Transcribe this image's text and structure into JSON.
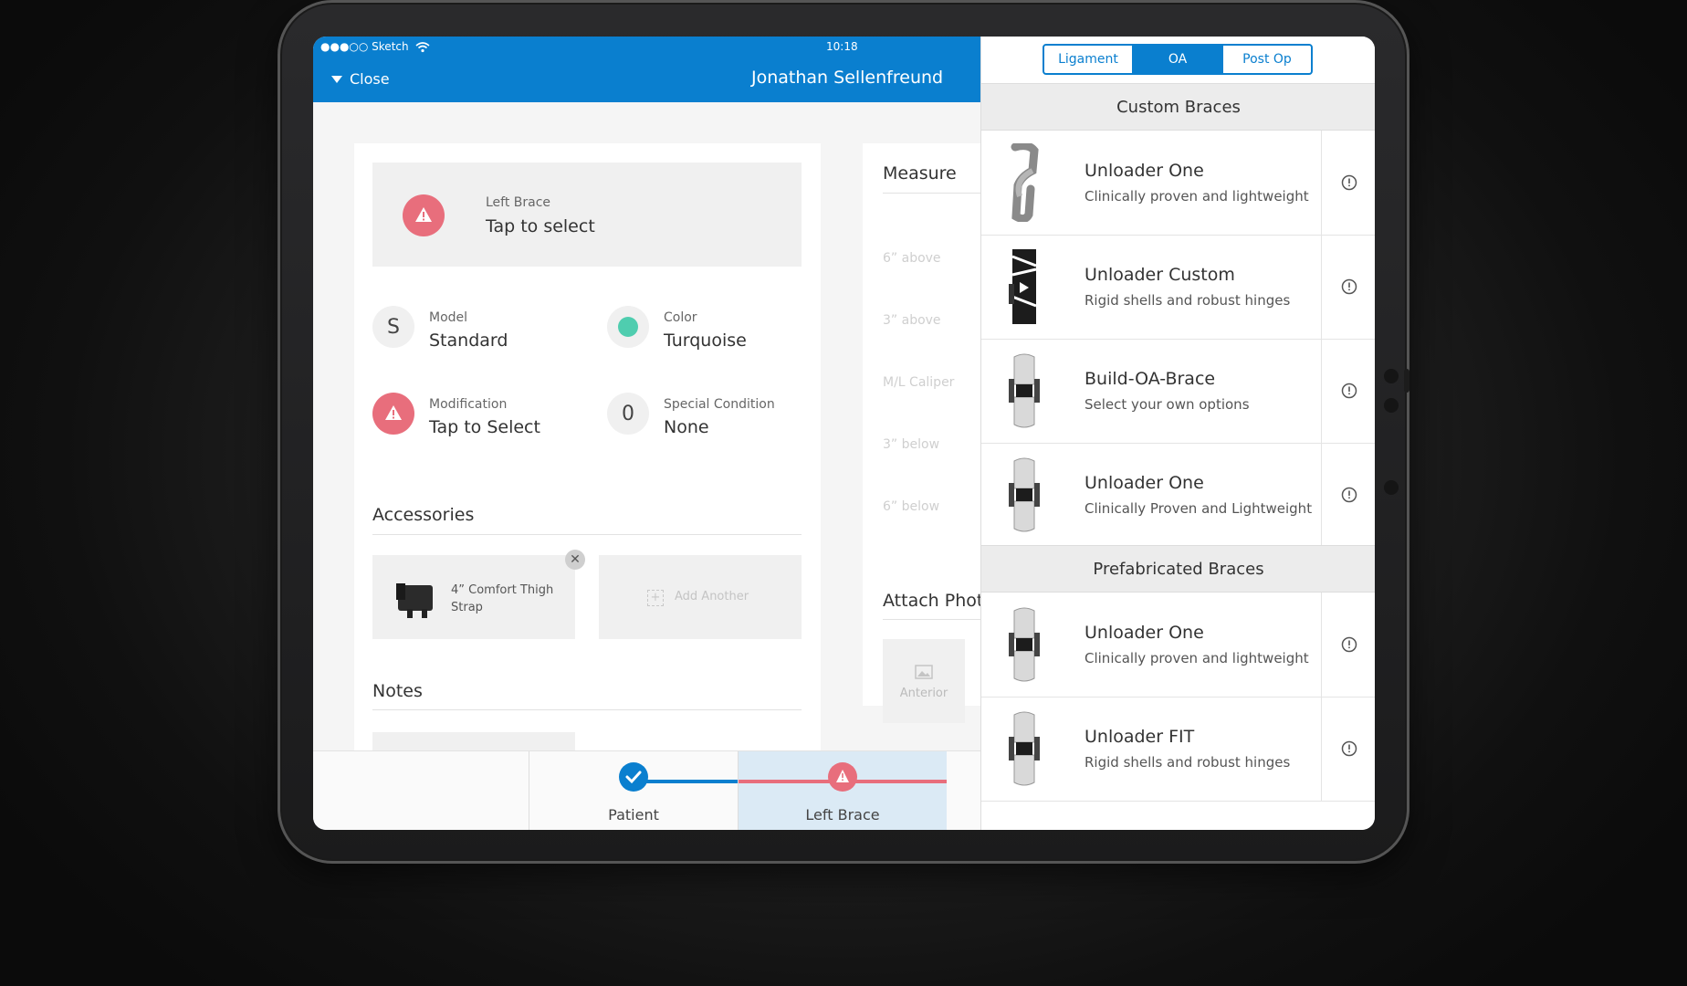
{
  "status_bar": {
    "carrier": "●●●○○ Sketch",
    "time": "10:18"
  },
  "header": {
    "close_label": "Close",
    "title": "Jonathan Sellenfreund"
  },
  "left_brace": {
    "caption": "Left Brace",
    "value": "Tap to select"
  },
  "fields": {
    "model": {
      "label": "Model",
      "value": "Standard",
      "badge": "S"
    },
    "color": {
      "label": "Color",
      "value": "Turquoise",
      "swatch": "#4fcdaf"
    },
    "modification": {
      "label": "Modification",
      "value": "Tap to Select"
    },
    "special_condition": {
      "label": "Special Condition",
      "value": "None",
      "badge": "0"
    }
  },
  "accessories": {
    "title": "Accessories",
    "items": [
      {
        "name": "4” Comfort Thigh Strap"
      }
    ],
    "add_label": "Add Another"
  },
  "notes": {
    "title": "Notes"
  },
  "measure": {
    "title": "Measure",
    "rows": [
      "6” above",
      "3” above",
      "M/L Caliper",
      "3” below",
      "6” below"
    ],
    "attach_title": "Attach Phot",
    "photo_label": "Anterior"
  },
  "steps": [
    {
      "label": "Patient",
      "state": "done"
    },
    {
      "label": "Left Brace",
      "state": "warning"
    }
  ],
  "panel": {
    "tabs": [
      {
        "label": "Ligament",
        "active": false
      },
      {
        "label": "OA",
        "active": true
      },
      {
        "label": "Post Op",
        "active": false
      }
    ],
    "custom_title": "Custom Braces",
    "custom": [
      {
        "name": "Unloader One",
        "desc": "Clinically proven and lightweight"
      },
      {
        "name": "Unloader Custom",
        "desc": "Rigid shells and robust hinges"
      },
      {
        "name": "Build-OA-Brace",
        "desc": "Select your own options"
      },
      {
        "name": "Unloader One",
        "desc": "Clinically Proven and Lightweight"
      }
    ],
    "prefab_title": "Prefabricated Braces",
    "prefab": [
      {
        "name": "Unloader One",
        "desc": "Clinically proven and lightweight"
      },
      {
        "name": "Unloader FIT",
        "desc": "Rigid shells and robust hinges"
      }
    ]
  },
  "colors": {
    "primary": "#0a7fcf",
    "warning": "#e86e7c",
    "turquoise": "#4fcdaf"
  }
}
